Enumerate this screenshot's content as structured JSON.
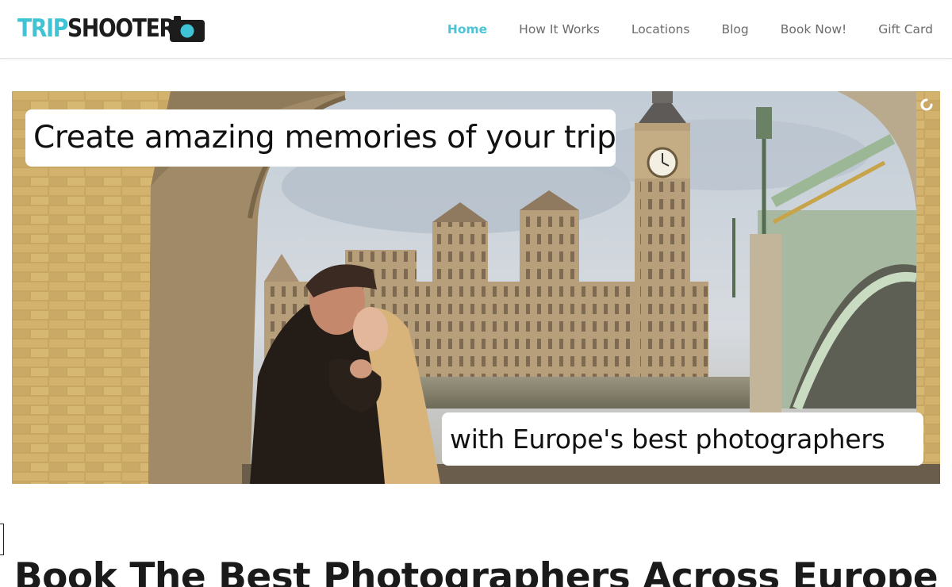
{
  "brand": {
    "part1": "TRIP",
    "part2": "SHOOTER",
    "icon": "camera-icon",
    "colors": {
      "accent": "#3fc4d6",
      "dark": "#1c1c1c"
    }
  },
  "nav": {
    "items": [
      {
        "label": "Home",
        "active": true
      },
      {
        "label": "How It Works",
        "active": false
      },
      {
        "label": "Locations",
        "active": false
      },
      {
        "label": "Blog",
        "active": false
      },
      {
        "label": "Book Now!",
        "active": false
      },
      {
        "label": "Gift Card",
        "active": false
      }
    ]
  },
  "hero": {
    "caption_top": "Create amazing memories of your trip",
    "caption_bottom": "with Europe's best photographers",
    "image_subject": "couple-kissing-under-arch-westminster-big-ben"
  },
  "section": {
    "title": "Book The Best Photographers Across Europe"
  }
}
